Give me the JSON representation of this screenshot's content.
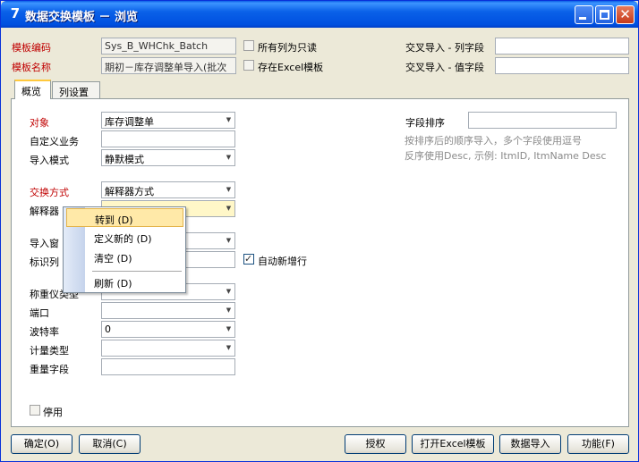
{
  "window": {
    "title": "数据交换模板 － 浏览",
    "app_icon": "7"
  },
  "header": {
    "template_code_label": "模板编码",
    "template_code_value": "Sys_B_WHChk_Batch",
    "template_name_label": "模板名称",
    "template_name_value": "期初－库存调整单导入(批次",
    "all_readonly_label": "所有列为只读",
    "excel_template_label": "存在Excel模板",
    "cross_col_label": "交叉导入 - 列字段",
    "cross_val_label": "交叉导入 - 值字段",
    "cross_col_value": "",
    "cross_val_value": ""
  },
  "tabs": [
    {
      "label": "概览",
      "active": true
    },
    {
      "label": "列设置",
      "active": false
    }
  ],
  "form": {
    "object_label": "对象",
    "object_value": "库存调整单",
    "custom_biz_label": "自定义业务",
    "custom_biz_value": "",
    "import_mode_label": "导入模式",
    "import_mode_value": "静默模式",
    "exchange_method_label": "交换方式",
    "exchange_method_value": "解释器方式",
    "parser_label": "解释器",
    "parser_value": "",
    "import_window_label": "导入窗",
    "identifier_label": "标识列",
    "auto_add_row_label": "自动新增行",
    "scale_type_label": "称重仪类型",
    "port_label": "端口",
    "baud_label": "波特率",
    "baud_value": "0",
    "measure_type_label": "计量类型",
    "weight_field_label": "重量字段",
    "disabled_label": "停用",
    "field_sort_label": "字段排序",
    "field_sort_value": "",
    "hint_line1": "按排序后的顺序导入，多个字段使用逗号",
    "hint_line2": "反序使用Desc, 示例: ItmID, ItmName Desc"
  },
  "context_menu": {
    "items": [
      {
        "label": "转到 (D)"
      },
      {
        "label": "定义新的 (D)"
      },
      {
        "label": "清空 (D)"
      },
      {
        "label": "刷新 (D)"
      }
    ]
  },
  "buttons": {
    "ok": "确定(O)",
    "cancel": "取消(C)",
    "authorize": "授权",
    "open_excel": "打开Excel模板",
    "data_import": "数据导入",
    "functions": "功能(F)"
  },
  "colors": {
    "required_label": "#C00000",
    "titlebar": "#0A5FE6",
    "menu_highlight": "#FFE9A8"
  }
}
